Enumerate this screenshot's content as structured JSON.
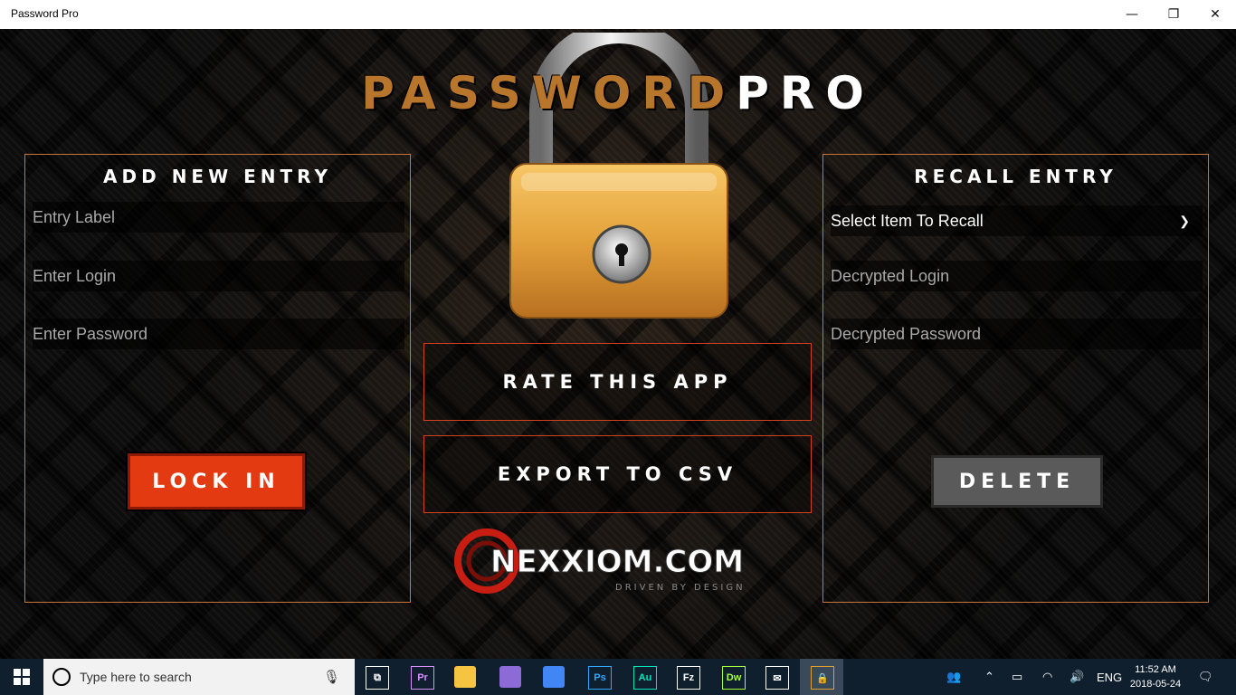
{
  "window": {
    "title": "Password Pro",
    "minimize_glyph": "—",
    "maximize_glyph": "❐",
    "close_glyph": "✕"
  },
  "logo": {
    "part1": "PASSWORD",
    "part2": "PRO"
  },
  "add_panel": {
    "heading": "ADD NEW ENTRY",
    "label_placeholder": "Entry Label",
    "login_placeholder": "Enter Login",
    "password_placeholder": "Enter Password",
    "lock_button": "LOCK IN"
  },
  "center": {
    "rate_button": "RATE THIS APP",
    "export_button": "EXPORT TO CSV",
    "brand_name": "NEXXIOM.COM",
    "brand_tagline": "DRIVEN BY DESIGN"
  },
  "recall_panel": {
    "heading": "RECALL ENTRY",
    "select_value": "Select Item To Recall",
    "login_placeholder": "Decrypted Login",
    "password_placeholder": "Decrypted Password",
    "delete_button": "DELETE"
  },
  "taskbar": {
    "search_placeholder": "Type here to search",
    "apps": [
      {
        "icon": "task-view-icon",
        "text": "⧉",
        "color": "#ffffff"
      },
      {
        "icon": "premiere-icon",
        "text": "Pr",
        "color": "#d691ff"
      },
      {
        "icon": "file-explorer-icon",
        "text": "",
        "color": "#f5c542"
      },
      {
        "icon": "visual-studio-icon",
        "text": "",
        "color": "#8c6bd6"
      },
      {
        "icon": "chrome-icon",
        "text": "",
        "color": "#4285f4"
      },
      {
        "icon": "photoshop-icon",
        "text": "Ps",
        "color": "#31a8ff"
      },
      {
        "icon": "audition-icon",
        "text": "Au",
        "color": "#00e4bb"
      },
      {
        "icon": "filezilla-icon",
        "text": "Fz",
        "color": "#ffffff"
      },
      {
        "icon": "dreamweaver-icon",
        "text": "Dw",
        "color": "#a5ff3a"
      },
      {
        "icon": "mail-icon",
        "text": "✉",
        "color": "#ffffff"
      },
      {
        "icon": "password-pro-icon",
        "text": "🔒",
        "color": "#e0a030"
      }
    ],
    "language": "ENG",
    "time": "11:52 AM",
    "date": "2018-05-24"
  }
}
